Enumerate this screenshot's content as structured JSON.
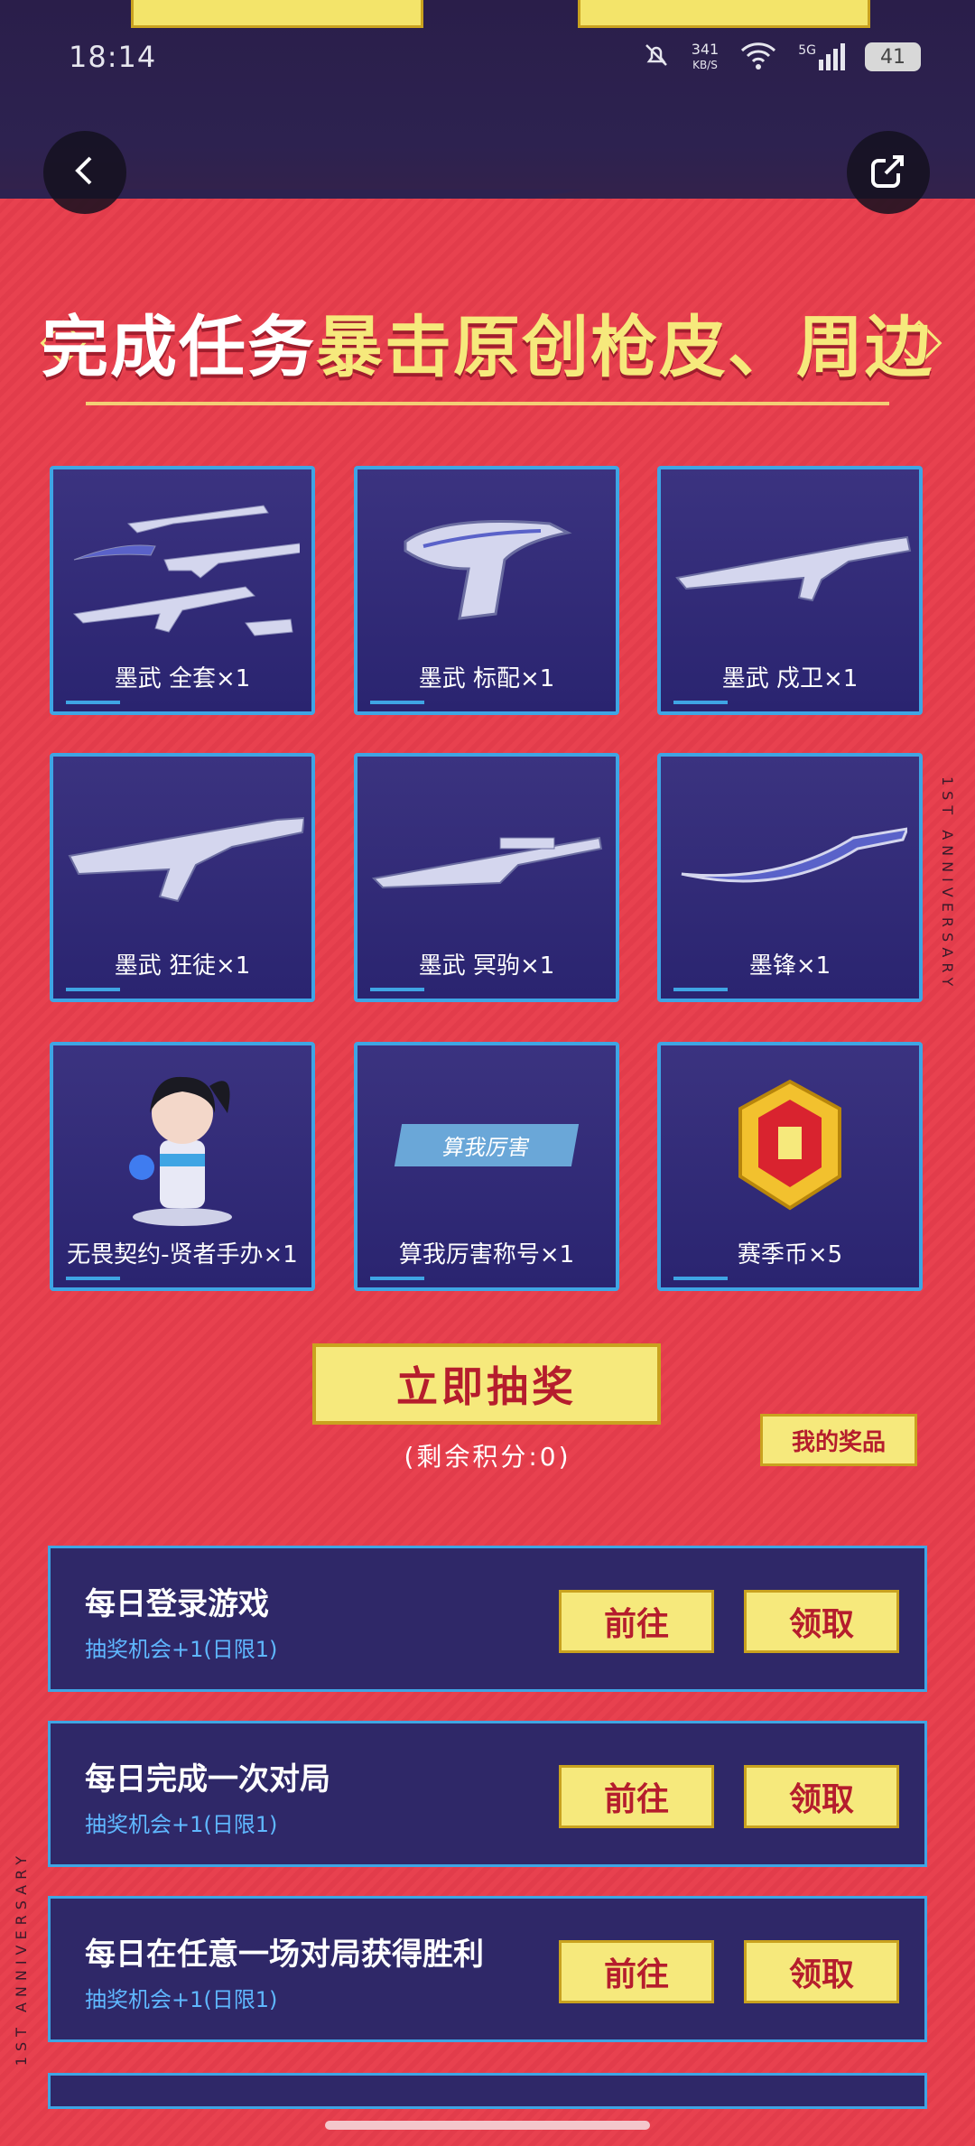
{
  "status_bar": {
    "time": "18:14",
    "net_speed": "341",
    "net_unit": "KB/S",
    "signal": "5G",
    "battery": "41"
  },
  "header": {
    "title_part1": "完成任务",
    "title_part2": "暴击原创枪皮、周边"
  },
  "rewards": [
    {
      "label": "墨武 全套×1"
    },
    {
      "label": "墨武 标配×1"
    },
    {
      "label": "墨武 戍卫×1"
    },
    {
      "label": "墨武 狂徒×1"
    },
    {
      "label": "墨武 冥驹×1"
    },
    {
      "label": "墨锋×1"
    },
    {
      "label": "无畏契约-贤者手办×1"
    },
    {
      "label": "算我厉害称号×1",
      "badge": "算我厉害"
    },
    {
      "label": "赛季币×5"
    }
  ],
  "draw": {
    "button_label": "立即抽奖",
    "points_text": "(剩余积分:0)",
    "my_prizes_label": "我的奖品"
  },
  "side_text": "1ST ANNIVERSARY",
  "tasks": [
    {
      "title": "每日登录游戏",
      "subtitle": "抽奖机会+1(日限1)",
      "go_label": "前往",
      "claim_label": "领取"
    },
    {
      "title": "每日完成一次对局",
      "subtitle": "抽奖机会+1(日限1)",
      "go_label": "前往",
      "claim_label": "领取"
    },
    {
      "title": "每日在任意一场对局获得胜利",
      "subtitle": "抽奖机会+1(日限1)",
      "go_label": "前往",
      "claim_label": "领取"
    }
  ],
  "colors": {
    "accent_red": "#e8414f",
    "accent_yellow": "#f6e97c",
    "card_blue": "#2f2868",
    "border_blue": "#3fa5e4"
  }
}
